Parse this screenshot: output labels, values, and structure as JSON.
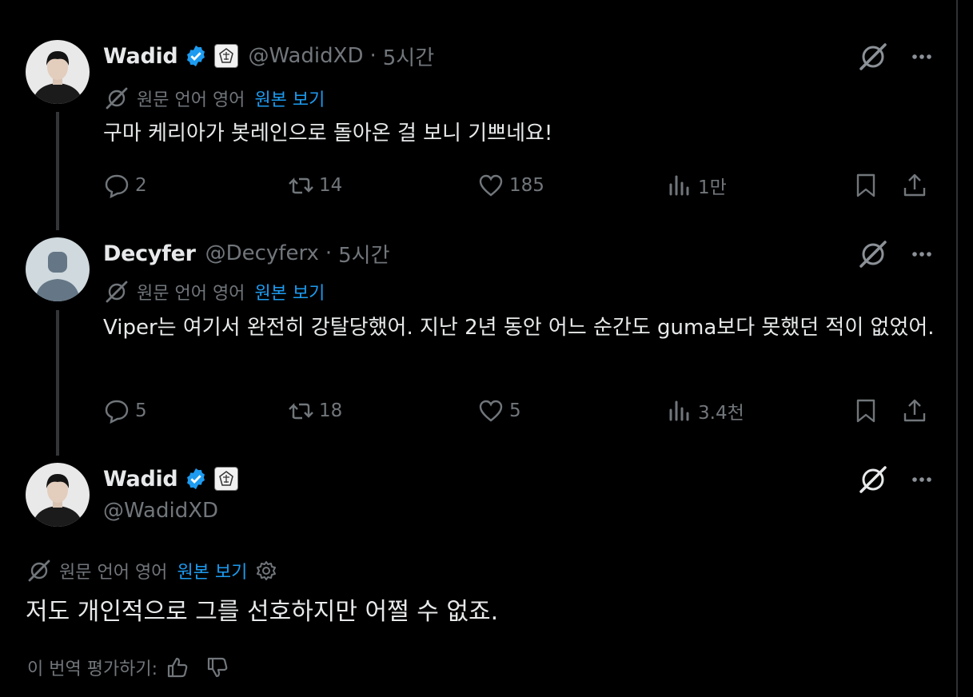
{
  "tweets": [
    {
      "name": "Wadid",
      "handle": "@WadidXD",
      "separator": "·",
      "time": "5시간",
      "translate_info": "원문 언어 영어",
      "view_original": "원본 보기",
      "text": "구마 케리아가 봇레인으로 돌아온 걸 보니 기쁘네요!",
      "stats": {
        "replies": "2",
        "reposts": "14",
        "likes": "185",
        "views": "1만"
      }
    },
    {
      "name": "Decyfer",
      "handle": "@Decyferx",
      "separator": "·",
      "time": "5시간",
      "translate_info": "원문 언어 영어",
      "view_original": "원본 보기",
      "text": "Viper는 여기서 완전히 강탈당했어. 지난 2년 동안 어느 순간도 guma보다 못했던 적이 없었어.",
      "stats": {
        "replies": "5",
        "reposts": "18",
        "likes": "5",
        "views": "3.4천"
      }
    }
  ],
  "main_tweet": {
    "name": "Wadid",
    "handle": "@WadidXD",
    "translate_info": "원문 언어 영어",
    "view_original": "원본 보기",
    "text": "저도 개인적으로 그를 선호하지만 어쩔 수 없죠.",
    "rate_label": "이 번역 평가하기:"
  },
  "colors": {
    "background": "#000000",
    "text": "#e7e9ea",
    "muted": "#71767b",
    "link": "#1d9bf0",
    "verified": "#1d9bf0",
    "thread_line": "#333639"
  },
  "icons": [
    "verified-badge-icon",
    "affiliate-badge-icon",
    "translate-icon",
    "reply-icon",
    "repost-icon",
    "like-icon",
    "views-icon",
    "bookmark-icon",
    "share-icon",
    "grok-icon",
    "more-icon",
    "gear-icon",
    "thumbs-up-icon",
    "thumbs-down-icon"
  ]
}
